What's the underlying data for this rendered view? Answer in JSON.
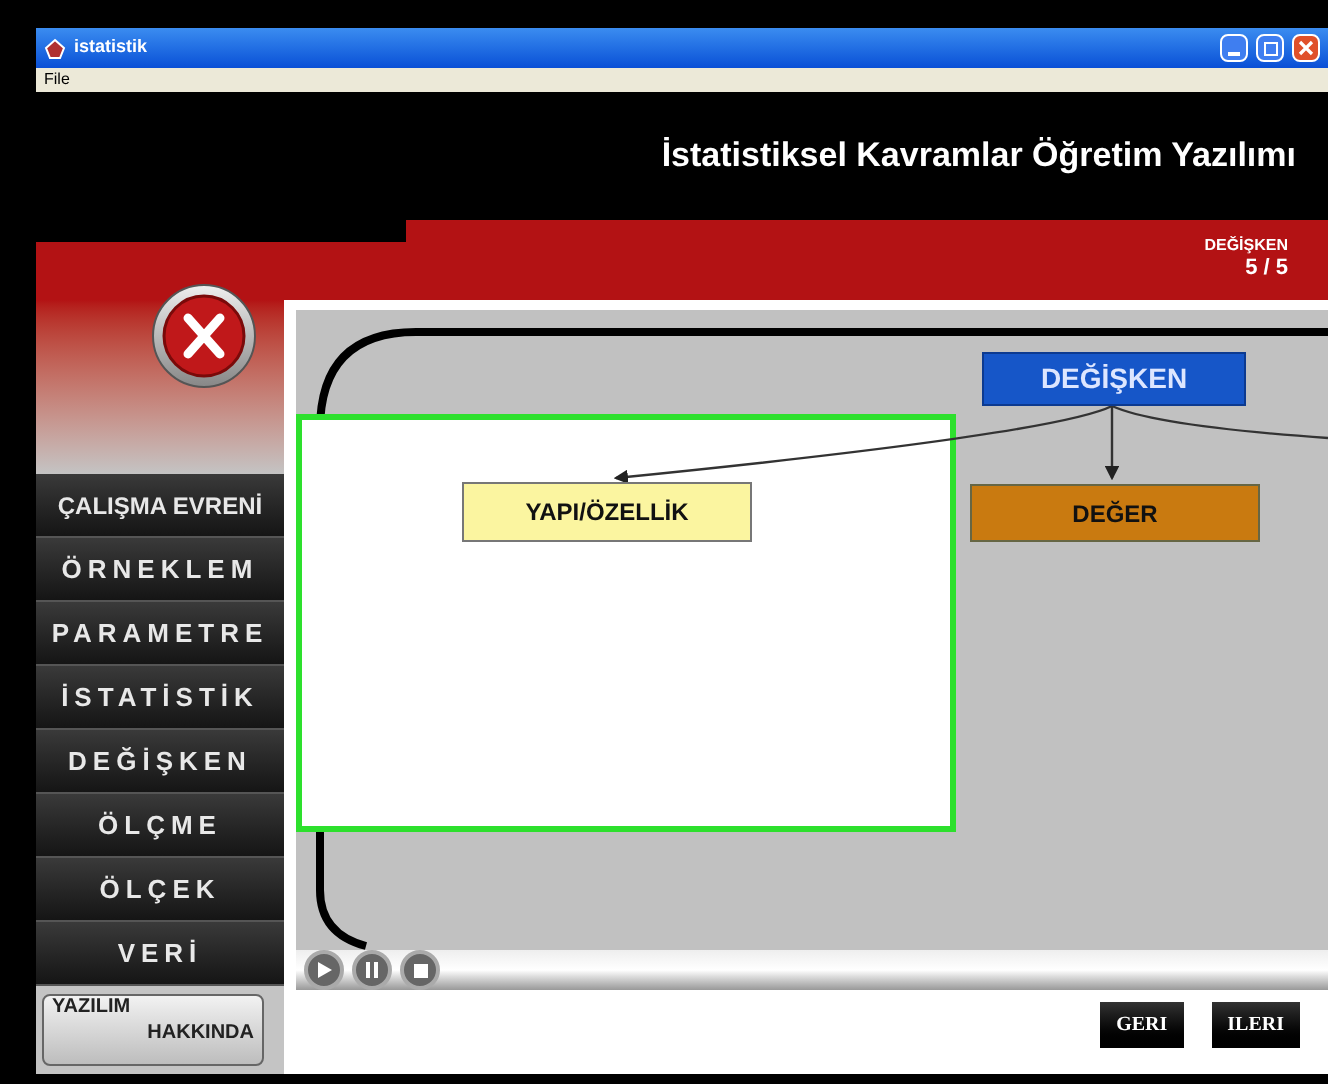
{
  "window": {
    "title": "istatistik"
  },
  "menu": [
    "File"
  ],
  "app_title": "İstatistiksel Kavramlar Öğretim Yazılımı",
  "section": {
    "label": "DEĞİŞKEN",
    "counter": "5 / 5"
  },
  "nav": [
    {
      "label": "ÇALIŞMA EVRENİ",
      "kind": "tight"
    },
    {
      "label": "ÖRNEKLEM",
      "kind": "spaced"
    },
    {
      "label": "PARAMETRE",
      "kind": "spaced"
    },
    {
      "label": "İSTATİSTİK",
      "kind": "spaced"
    },
    {
      "label": "DEĞİŞKEN",
      "kind": "spaced"
    },
    {
      "label": "ÖLÇME",
      "kind": "spaced"
    },
    {
      "label": "ÖLÇEK",
      "kind": "spaced"
    },
    {
      "label": "VERİ",
      "kind": "spaced"
    }
  ],
  "about_button": [
    "YAZILIM",
    "HAKKINDA"
  ],
  "diagram": {
    "root": "DEĞİŞKEN",
    "children": [
      "YAPI/ÖZELLİK",
      "DEĞER"
    ]
  },
  "step_buttons": [
    "GERI",
    "ILERI"
  ]
}
